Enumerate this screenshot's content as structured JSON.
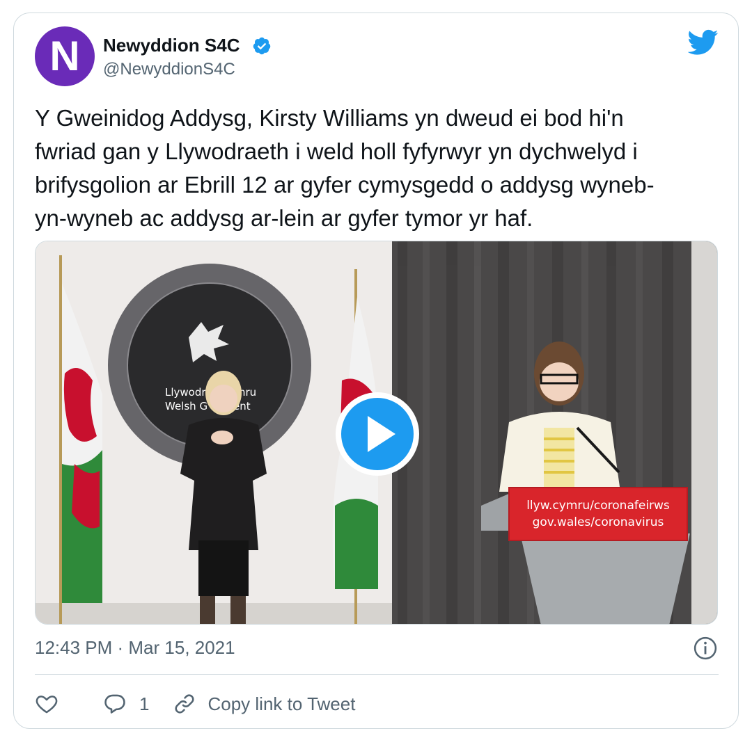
{
  "tweet": {
    "author": {
      "display_name": "Newyddion S4C",
      "handle": "@NewyddionS4C",
      "avatar_letter": "N",
      "avatar_color": "#6a2bb8",
      "verified": true
    },
    "text": "Y Gweinidog Addysg, Kirsty Williams yn dweud ei bod hi'n\nfwriad gan y Llywodraeth i weld holl fyfyrwyr yn dychwelyd i\nbrifysgolion ar Ebrill 12 ar gyfer cymysgedd o addysg wyneb-\nyn-wyneb ac addysg ar-lein ar gyfer tymor yr haf.",
    "timestamp": "12:43 PM · Mar 15, 2021",
    "reply_count": "1",
    "copy_link_label": "Copy link to Tweet"
  },
  "video": {
    "emblem_line1": "Llywodr",
    "emblem_line1b": "ymru",
    "emblem_line2": "Welsh G",
    "emblem_line2b": "ent",
    "podium_line1": "llyw.cymru/coronafeirws",
    "podium_line2": "gov.wales/coronavirus"
  },
  "icons": {
    "verified": "verified-badge-icon",
    "brand": "twitter-bird-icon",
    "play": "play-icon",
    "info": "info-icon",
    "like": "heart-icon",
    "reply": "reply-bubble-icon",
    "copy": "link-icon"
  },
  "colors": {
    "accent": "#1d9bf0",
    "text": "#0f1419",
    "secondary": "#536471",
    "podium_red": "#d9252b"
  }
}
